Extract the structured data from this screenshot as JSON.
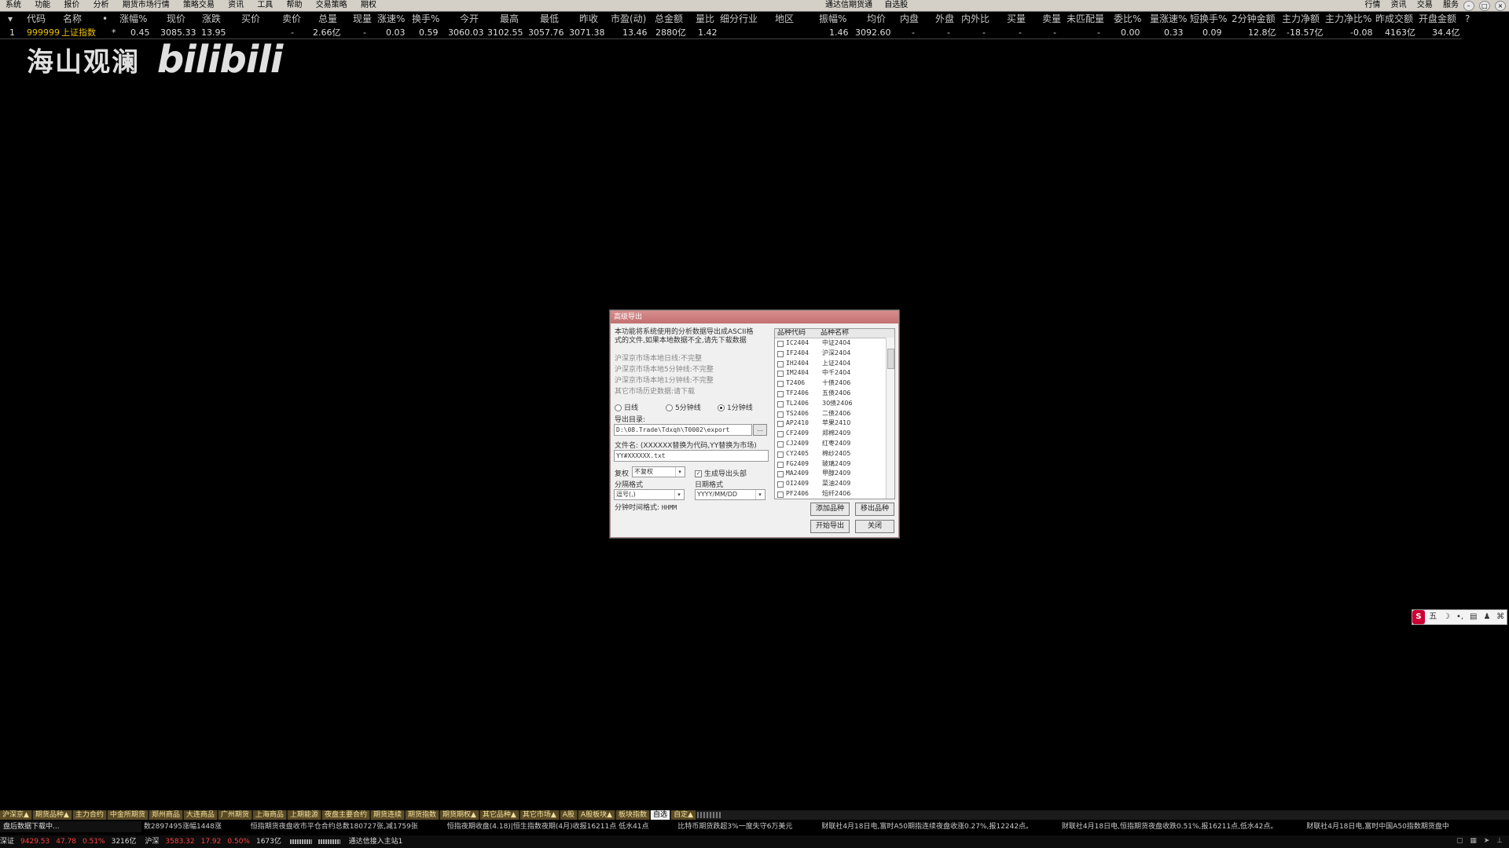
{
  "menubar": {
    "items": [
      "系统",
      "功能",
      "报价",
      "分析",
      "期货市场行情",
      "策略交易",
      "资讯",
      "工具",
      "帮助",
      "交易策略",
      "期权"
    ],
    "center": [
      "通达信期货通",
      "自选股"
    ],
    "right": [
      "行情",
      "资讯",
      "交易",
      "服务"
    ],
    "winctl": [
      "–",
      "□",
      "×"
    ]
  },
  "quote": {
    "headers": [
      "代码",
      "名称",
      "•",
      "涨幅%",
      "现价",
      "涨跌",
      "买价",
      "卖价",
      "总量",
      "现量",
      "涨速%",
      "换手%",
      "今开",
      "最高",
      "最低",
      "昨收",
      "市盈(动)",
      "总金额",
      "量比",
      "细分行业",
      "地区",
      "振幅%",
      "均价",
      "内盘",
      "外盘",
      "内外比",
      "买量",
      "卖量",
      "未匹配量",
      "委比%",
      "量涨速%",
      "短换手%",
      "2分钟金额",
      "主力净额",
      "主力净比%",
      "昨成交额",
      "开盘金额",
      "?"
    ],
    "row": {
      "index": "1",
      "code": "999999",
      "name": "上证指数",
      "flag": "*",
      "change_pct": "0.45",
      "price": "3085.33",
      "change": "13.95",
      "bid": "",
      "ask": "-",
      "volume": "2.66亿",
      "cur_vol": "-",
      "speed": "0.03",
      "turnover": "0.59",
      "open": "3060.03",
      "high": "3102.55",
      "low": "3057.76",
      "prev_close": "3071.38",
      "pe": "13.46",
      "amount": "2880亿",
      "vol_ratio": "1.42",
      "amplitude": "1.46",
      "avg_price": "3092.60",
      "inner": "-",
      "outer": "-",
      "io_ratio": "-",
      "buy_vol": "-",
      "sell_vol": "-",
      "unmatched": "-",
      "commit_ratio": "0.00",
      "vol_speed": "0.33",
      "short_turnover": "0.09",
      "two_min_amount": "12.8亿",
      "main_net": "-18.57亿",
      "main_net_ratio": "-0.08",
      "prev_amount": "4163亿",
      "open_amount": "34.4亿"
    }
  },
  "watermark": {
    "text": "海山观澜",
    "logo": "bilibili"
  },
  "dialog": {
    "title": "高级导出",
    "intro": "本功能将系统使用的分析数据导出成ASCII格式的文件,如果本地数据不全,请先下载数据",
    "status_lines": [
      "沪深京市场本地日线:不完整",
      "沪深京市场本地5分钟线:不完整",
      "沪深京市场本地1分钟线:不完整",
      "其它市场历史数据:请下载"
    ],
    "radios": [
      {
        "label": "日线",
        "checked": false
      },
      {
        "label": "5分钟线",
        "checked": false
      },
      {
        "label": "1分钟线",
        "checked": true
      }
    ],
    "export_dir_label": "导出目录:",
    "export_dir_value": "D:\\08.Trade\\Tdxqh\\T0002\\export",
    "browse_label": "...",
    "filename_label": "文件名: (XXXXXX替换为代码,YY替换为市场)",
    "filename_value": "YY#XXXXXX.txt",
    "fq_label": "复权",
    "fq_value": "不复权",
    "header_check_label": "生成导出头部",
    "header_checked": true,
    "sep_label": "分隔格式",
    "sep_value": "逗号(,)",
    "date_label": "日期格式",
    "date_value": "YYYY/MM/DD",
    "time_label": "分钟时间格式:",
    "time_value": "HHMM",
    "list_header_code": "品种代码",
    "list_header_name": "品种名称",
    "products": [
      {
        "code": "IC2404",
        "name": "中证2404"
      },
      {
        "code": "IF2404",
        "name": "沪深2404"
      },
      {
        "code": "IH2404",
        "name": "上证2404"
      },
      {
        "code": "IM2404",
        "name": "中千2404"
      },
      {
        "code": "T2406",
        "name": "十债2406"
      },
      {
        "code": "TF2406",
        "name": "五债2406"
      },
      {
        "code": "TL2406",
        "name": "30债2406"
      },
      {
        "code": "TS2406",
        "name": "二债2406"
      },
      {
        "code": "AP2410",
        "name": "苹果2410"
      },
      {
        "code": "CF2409",
        "name": "郑棉2409"
      },
      {
        "code": "CJ2409",
        "name": "红枣2409"
      },
      {
        "code": "CY2405",
        "name": "棉纱2405"
      },
      {
        "code": "FG2409",
        "name": "玻璃2409"
      },
      {
        "code": "MA2409",
        "name": "甲醇2409"
      },
      {
        "code": "OI2409",
        "name": "菜油2409"
      },
      {
        "code": "PF2406",
        "name": "短纤2406"
      }
    ],
    "buttons": {
      "add": "添加品种",
      "remove": "移出品种",
      "start": "开始导出",
      "close": "关闭"
    }
  },
  "ime": {
    "items": [
      "S",
      "五",
      "☽",
      "•,",
      "▤",
      "♟",
      "⌘"
    ]
  },
  "tabs": [
    {
      "label": "沪深京▲",
      "selected": false
    },
    {
      "label": "期货品种▲",
      "selected": false
    },
    {
      "label": "主力合约",
      "selected": false
    },
    {
      "label": "中金所期货",
      "selected": false
    },
    {
      "label": "郑州商品",
      "selected": false
    },
    {
      "label": "大连商品",
      "selected": false
    },
    {
      "label": "广州期货",
      "selected": false
    },
    {
      "label": "上海商品",
      "selected": false
    },
    {
      "label": "上期能源",
      "selected": false
    },
    {
      "label": "夜盘主要合约",
      "selected": false
    },
    {
      "label": "期货连续",
      "selected": false
    },
    {
      "label": "期货指数",
      "selected": false
    },
    {
      "label": "期货期权▲",
      "selected": false
    },
    {
      "label": "其它品种▲",
      "selected": false
    },
    {
      "label": "其它市场▲",
      "selected": false
    },
    {
      "label": "A股",
      "selected": false
    },
    {
      "label": "A股板块▲",
      "selected": false
    },
    {
      "label": "板块指数",
      "selected": false
    },
    {
      "label": "自选",
      "selected": true
    },
    {
      "label": "自定▲",
      "selected": false
    }
  ],
  "news": {
    "loading": "盘后数据下载中...",
    "items": [
      "数2897495涨幅1448涨",
      "恒指期货夜盘收市平仓合约总数180727张,减1759张",
      "恒指夜期收盘(4.18)|恒生指数夜期(4月)收报16211点 低水41点",
      "比特币期货跌超3%一度失守6万美元",
      "财联社4月18日电,富时A50期指连续夜盘收涨0.27%,报12242点。",
      "财联社4月18日电,恒指期货夜盘收跌0.51%,报16211点,低水42点。",
      "财联社4月18日电,富时中国A50指数期货盘中"
    ]
  },
  "bottombar": {
    "sh_name": "深证",
    "sh_value": "9429.53",
    "sh_change": "47.78",
    "sh_pct": "0.51%",
    "sh_amount": "3216亿",
    "hs_name": "沪深",
    "hs_value": "3583.32",
    "hs_change": "17.92",
    "hs_pct": "0.50%",
    "hs_amount": "1673亿",
    "connection": "通达信接入主站1"
  },
  "colors": {
    "accent_title": "#c47070",
    "tab_bg": "#5a4a24",
    "up": "#ff4040",
    "code_color": "#e8c000"
  }
}
